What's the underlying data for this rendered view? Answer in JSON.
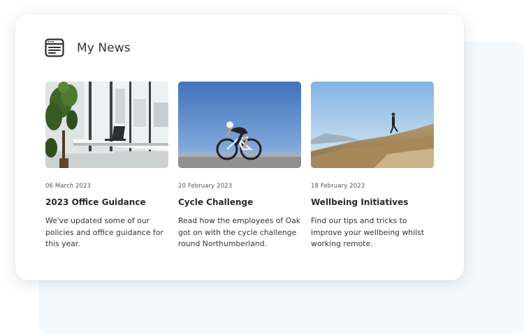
{
  "widget": {
    "title": "My News",
    "icon": "news-browser-icon"
  },
  "articles": [
    {
      "date": "06 March 2023",
      "headline": "2023 Office Guidance",
      "description": "We've updated some of our policies and office guidance for this year.",
      "image": "office-photo"
    },
    {
      "date": "20 February 2023",
      "headline": "Cycle Challenge",
      "description": "Read how the employees of Oak got on with the cycle challenge round Northumberland.",
      "image": "cyclist-photo"
    },
    {
      "date": "18 February 2023",
      "headline": "Wellbeing Initiatives",
      "description": "Find our tips and tricks to improve your wellbeing whilst working remote.",
      "image": "hill-runner-photo"
    }
  ],
  "colors": {
    "page_bg": "#ffffff",
    "backdrop_panel": "#f3f9fd",
    "card_bg": "#ffffff",
    "text": "#2a2a2a"
  }
}
